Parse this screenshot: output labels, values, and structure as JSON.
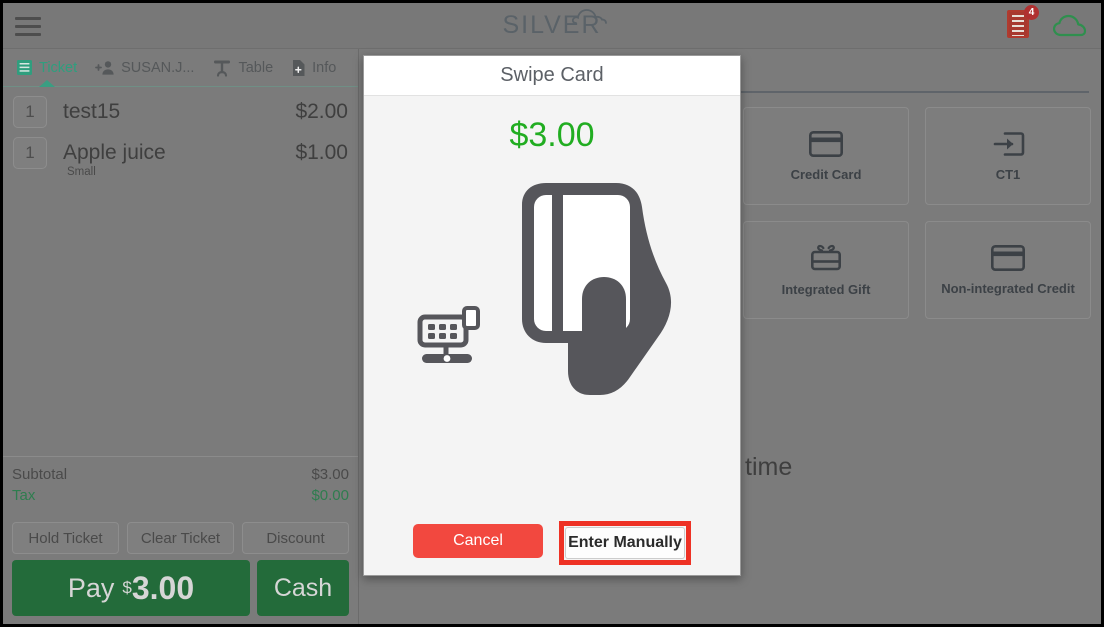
{
  "header": {
    "menu_icon": "hamburger-menu-icon",
    "logo_text": "SILVER",
    "logo_cloud_icon": "cloud-icon",
    "receipt_icon": "receipt-icon",
    "receipt_badge": "4",
    "cloud_sync_icon": "cloud-icon"
  },
  "tabs": [
    {
      "label": "Ticket",
      "icon": "ticket-list-icon",
      "active": true
    },
    {
      "label": "SUSAN.J...",
      "icon": "add-person-icon",
      "active": false
    },
    {
      "label": "Table",
      "icon": "table-icon",
      "active": false
    },
    {
      "label": "Info",
      "icon": "info-document-icon",
      "active": false
    }
  ],
  "ticket": {
    "items": [
      {
        "qty": "1",
        "name": "test15",
        "price": "$2.00",
        "modifier": ""
      },
      {
        "qty": "1",
        "name": "Apple juice",
        "price": "$1.00",
        "modifier": "Small"
      }
    ],
    "subtotal_label": "Subtotal",
    "subtotal_value": "$3.00",
    "tax_label": "Tax",
    "tax_value": "$0.00",
    "actions": [
      "Hold Ticket",
      "Clear Ticket",
      "Discount"
    ],
    "pay_label": "Pay",
    "pay_currency": "$",
    "pay_amount": "3.00",
    "cash_label": "Cash"
  },
  "payment_panel": {
    "tiles": [
      {
        "label": "Credit Card",
        "icon": "credit-card-icon"
      },
      {
        "label": "CT1",
        "icon": "arrow-into-box-icon"
      },
      {
        "label": "Integrated Gift",
        "icon": "gift-card-icon"
      },
      {
        "label": "Non-integrated Credit",
        "icon": "credit-card-icon"
      }
    ],
    "background_text": "at any time"
  },
  "modal": {
    "title": "Swipe Card",
    "amount": "$3.00",
    "illustration_terminal_icon": "card-terminal-icon",
    "illustration_hand_icon": "hand-holding-card-icon",
    "cancel_label": "Cancel",
    "manual_label": "Enter Manually"
  },
  "colors": {
    "accent_green": "#21ad21",
    "pay_green": "#236b3a",
    "danger_red": "#f2483f",
    "highlight_red": "#ee3124",
    "tab_active": "#2f9e7e"
  }
}
